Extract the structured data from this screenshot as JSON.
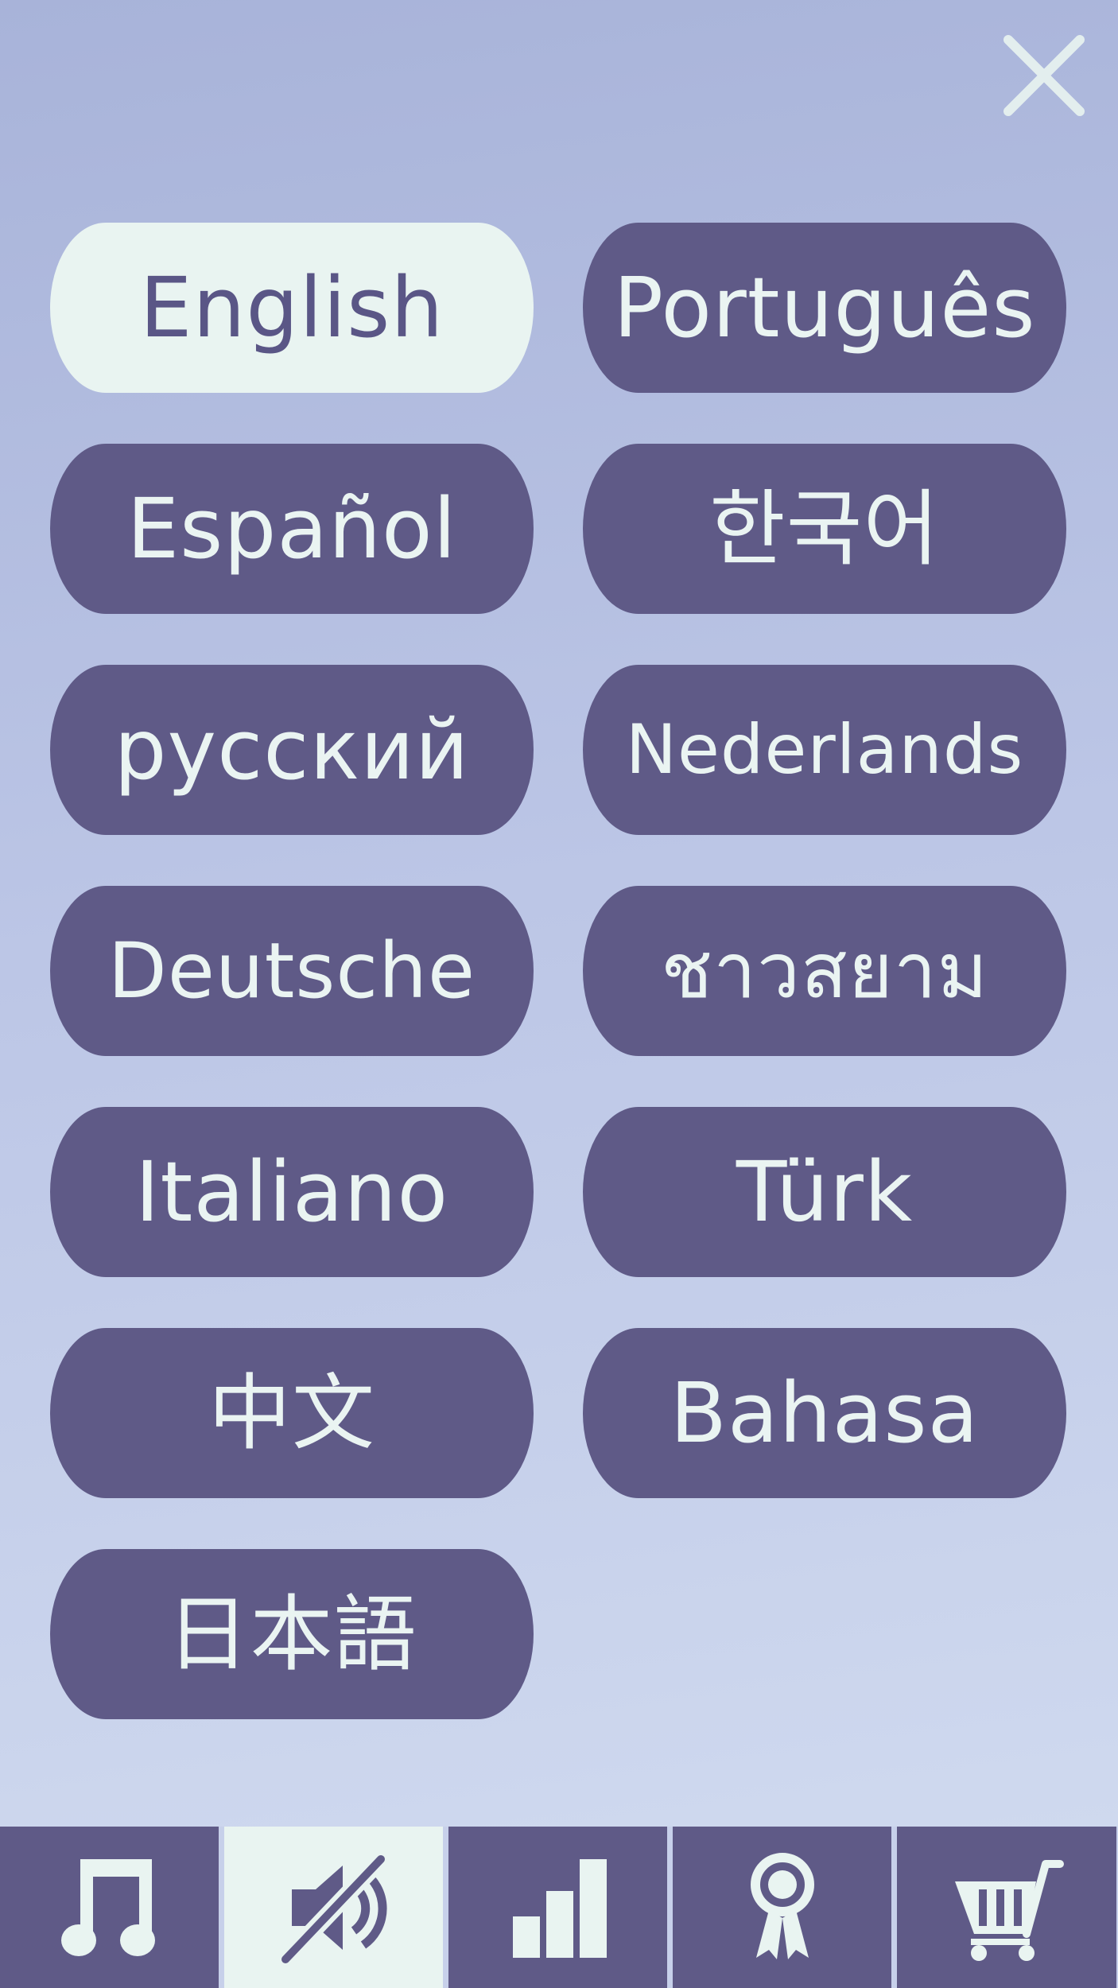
{
  "languages": [
    {
      "label": "English",
      "selected": true
    },
    {
      "label": "Português",
      "selected": false
    },
    {
      "label": "Español",
      "selected": false
    },
    {
      "label": "한국어",
      "selected": false
    },
    {
      "label": "русский",
      "selected": false
    },
    {
      "label": "Nederlands",
      "selected": false
    },
    {
      "label": "Deutsche",
      "selected": false
    },
    {
      "label": "ชาวสยาม",
      "selected": false
    },
    {
      "label": "Italiano",
      "selected": false
    },
    {
      "label": "Türk",
      "selected": false
    },
    {
      "label": "中文",
      "selected": false
    },
    {
      "label": "Bahasa",
      "selected": false
    },
    {
      "label": "日本語",
      "selected": false
    }
  ],
  "tabs": [
    {
      "icon": "music-note-icon",
      "active": false
    },
    {
      "icon": "sound-muted-icon",
      "active": true
    },
    {
      "icon": "bar-chart-icon",
      "active": false
    },
    {
      "icon": "award-ribbon-icon",
      "active": false
    },
    {
      "icon": "shopping-cart-icon",
      "active": false
    }
  ],
  "colors": {
    "button": "#5f5a87",
    "button_selected": "#e9f4f1",
    "text_light": "#eaf4f2",
    "text_dark": "#5a5686",
    "background_top": "#a8b3d9",
    "background_bottom": "#d2dcf0"
  }
}
